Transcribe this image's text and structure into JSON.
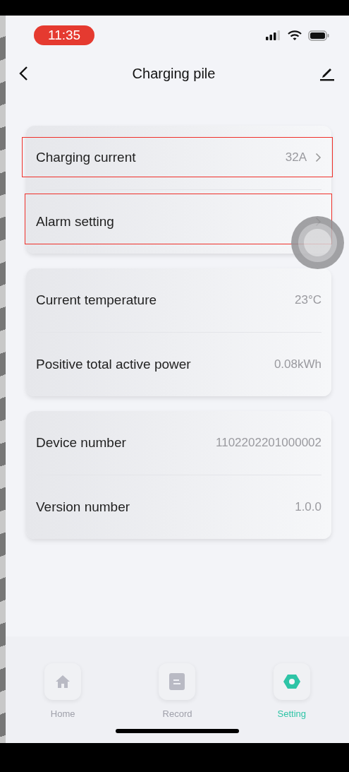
{
  "status_bar": {
    "time": "11:35"
  },
  "header": {
    "title": "Charging pile"
  },
  "groups": [
    {
      "rows": [
        {
          "kind": "link",
          "label": "Charging current",
          "value": "32A",
          "highlighted": true
        },
        {
          "kind": "link",
          "label": "Alarm setting",
          "highlighted": true
        }
      ]
    },
    {
      "rows": [
        {
          "kind": "info",
          "label": "Current temperature",
          "value": "23°C",
          "highlighted": false
        },
        {
          "kind": "info",
          "label": "Positive total active power",
          "value": "0.08kWh",
          "highlighted": false
        }
      ]
    },
    {
      "rows": [
        {
          "kind": "info",
          "label": "Device number",
          "value": "1102202201000002",
          "highlighted": false
        },
        {
          "kind": "info",
          "label": "Version number",
          "value": "1.0.0",
          "highlighted": false
        }
      ]
    }
  ],
  "tab_bar": [
    {
      "kind": "home",
      "label": "Home",
      "selected": false
    },
    {
      "kind": "record",
      "label": "Record",
      "selected": false
    },
    {
      "kind": "setting",
      "label": "Setting",
      "selected": true
    }
  ]
}
